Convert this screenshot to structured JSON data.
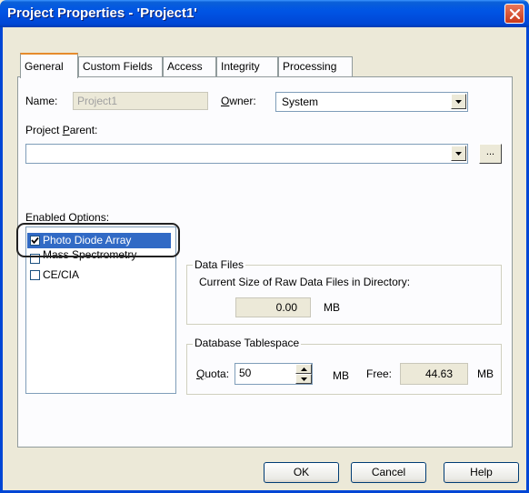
{
  "window": {
    "title": "Project Properties - 'Project1'"
  },
  "tabs": [
    {
      "label": "General"
    },
    {
      "label": "Custom Fields"
    },
    {
      "label": "Access"
    },
    {
      "label": "Integrity"
    },
    {
      "label": "Processing"
    }
  ],
  "general": {
    "name_label": "Name:",
    "name_value": "Project1",
    "owner_label_accel": "O",
    "owner_label_rest": "wner:",
    "owner_value": "System",
    "parent_label_pre": "Project ",
    "parent_label_accel": "P",
    "parent_label_rest": "arent:",
    "parent_value": "",
    "browse_label": "...",
    "enabled_options_label": "Enabled Options:",
    "options": [
      {
        "label": "Photo Diode Array",
        "checked": true
      },
      {
        "label": "Mass Spectrometry",
        "checked": false
      },
      {
        "label": "CE/CIA",
        "checked": false
      }
    ],
    "data_files": {
      "legend": "Data Files",
      "description": "Current Size of Raw Data Files in Directory:",
      "size_value": "0.00",
      "size_unit": "MB"
    },
    "tablespace": {
      "legend": "Database Tablespace",
      "quota_label_accel": "Q",
      "quota_label_rest": "uota:",
      "quota_value": "50",
      "quota_unit": "MB",
      "free_label": "Free:",
      "free_value": "44.63",
      "free_unit": "MB"
    }
  },
  "buttons": {
    "ok": "OK",
    "cancel": "Cancel",
    "help": "Help"
  },
  "colors": {
    "title_bar": "#0055e5",
    "selection": "#316ac5",
    "face": "#ece9d8"
  }
}
